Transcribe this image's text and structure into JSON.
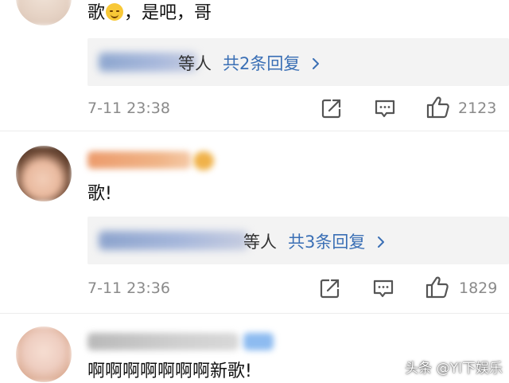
{
  "comments": [
    {
      "body_before": "歌",
      "emoji": "grinning-face-emoji",
      "body_after": "，是吧，哥",
      "reply_tail": "等人",
      "reply_link": "共2条回复",
      "reply_chevron": "›",
      "time": "7-11 23:38",
      "likes": "2123"
    },
    {
      "body": "歌!",
      "reply_tail": "等人",
      "reply_link": "共3条回复",
      "reply_chevron": "›",
      "time": "7-11 23:36",
      "likes": "1829"
    },
    {
      "body": "啊啊啊啊啊啊啊新歌!"
    }
  ],
  "icons": {
    "share": "share-icon",
    "comment": "comment-icon",
    "like": "thumbs-up-icon",
    "chevron": "chevron-right-icon"
  },
  "colors": {
    "link": "#3a6fb5",
    "meta": "#8a8a8a",
    "reply_bg": "#f3f3f3"
  },
  "watermark": "头条 @YI下娱乐"
}
